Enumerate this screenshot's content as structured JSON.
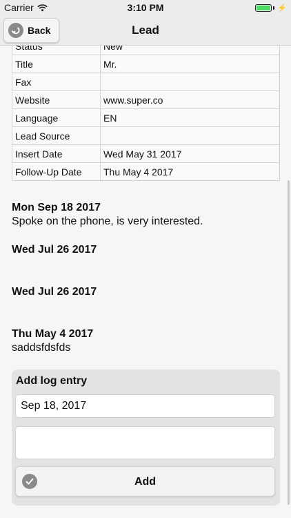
{
  "status_bar": {
    "carrier": "Carrier",
    "time": "3:10 PM"
  },
  "nav": {
    "back_label": "Back",
    "title": "Lead"
  },
  "details": [
    {
      "key": "Status",
      "value": "New"
    },
    {
      "key": "Title",
      "value": "Mr."
    },
    {
      "key": "Fax",
      "value": ""
    },
    {
      "key": "Website",
      "value": "www.super.co"
    },
    {
      "key": "Language",
      "value": "EN"
    },
    {
      "key": "Lead Source",
      "value": ""
    },
    {
      "key": "Insert Date",
      "value": "Wed May 31 2017"
    },
    {
      "key": "Follow-Up Date",
      "value": "Thu May 4 2017"
    }
  ],
  "log_entries": [
    {
      "date": "Mon Sep 18 2017",
      "note": "Spoke on the phone, is very interested."
    },
    {
      "date": "Wed Jul 26 2017",
      "note": ""
    },
    {
      "date": "Wed Jul 26 2017",
      "note": ""
    },
    {
      "date": "Thu May 4 2017",
      "note": "saddsfdsfds"
    }
  ],
  "add_log": {
    "title": "Add log entry",
    "date_value": "Sep 18, 2017",
    "note_value": "",
    "add_label": "Add"
  },
  "colors": {
    "battery": "#4cd964",
    "bar_bg": "#ececec",
    "panel_bg": "#e3e3e3"
  },
  "icons": {
    "back": "back-arrow-circle-icon",
    "add": "checkmark-circle-icon",
    "wifi": "wifi-icon",
    "battery": "battery-icon"
  }
}
